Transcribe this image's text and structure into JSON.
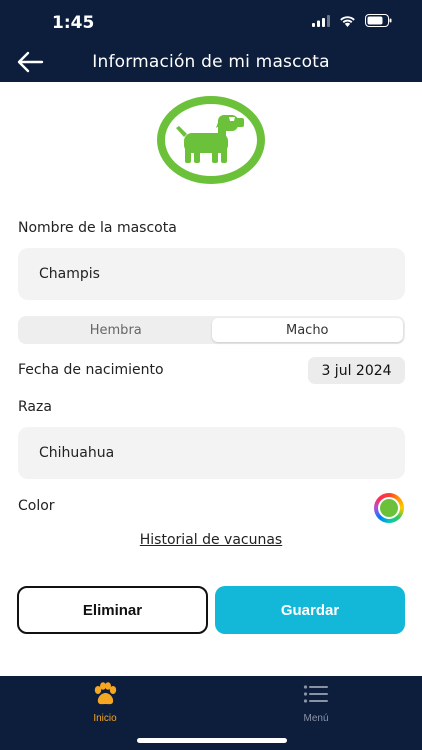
{
  "status_bar": {
    "time": "1:45"
  },
  "header": {
    "title": "Información de mi mascota"
  },
  "form": {
    "name_label": "Nombre de la mascota",
    "name_value": "Champis",
    "sex_options": [
      "Hembra",
      "Macho"
    ],
    "sex_selected": "Macho",
    "birth_label": "Fecha de nacimiento",
    "birth_value": "3 jul 2024",
    "breed_label": "Raza",
    "breed_value": "Chihuahua",
    "color_label": "Color",
    "color_value": "#6cc13b",
    "vaccine_link": "Historial de vacunas"
  },
  "actions": {
    "delete_label": "Eliminar",
    "save_label": "Guardar"
  },
  "tab_bar": {
    "items": [
      {
        "label": "Inicio",
        "icon": "paw-icon",
        "active": true
      },
      {
        "label": "Menú",
        "icon": "menu-icon",
        "active": false
      }
    ]
  },
  "colors": {
    "navy": "#0d1d3c",
    "accent_green": "#6cc13b",
    "save_button": "#13b8d8",
    "active_tab": "#f5a623"
  }
}
